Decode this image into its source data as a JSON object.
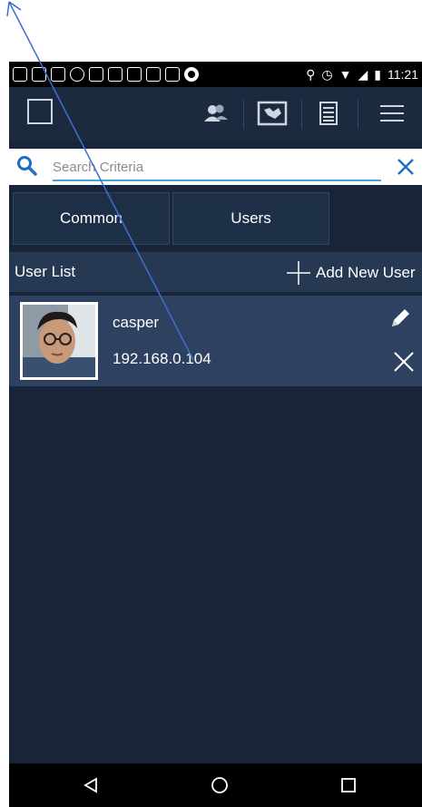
{
  "status_bar": {
    "time": "11:21"
  },
  "toolbar": {
    "icons": [
      "square-icon",
      "users-icon",
      "map-icon",
      "list-icon",
      "menu-icon"
    ]
  },
  "search": {
    "placeholder": "Search Criteria",
    "value": ""
  },
  "tabs": [
    {
      "label": "Common"
    },
    {
      "label": "Users"
    }
  ],
  "user_list": {
    "title": "User List",
    "add_label": "Add New User",
    "users": [
      {
        "name": "casper",
        "ip": "192.168.0.104"
      }
    ]
  },
  "colors": {
    "background": "#17243a",
    "toolbar": "#1c2a40",
    "row": "#2e4160",
    "accent_blue": "#1f6fc0",
    "annotation_line": "#3d6fd0"
  }
}
